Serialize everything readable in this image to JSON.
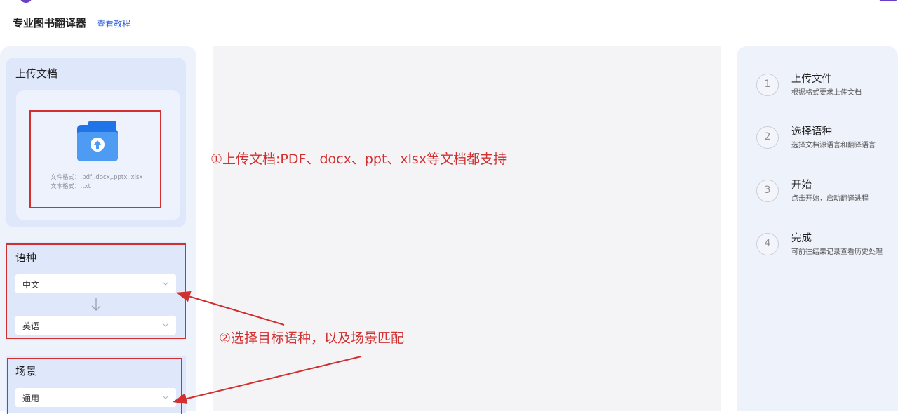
{
  "header": {
    "app_title": "专业图书翻译器",
    "tutorial_link": "查看教程"
  },
  "upload": {
    "heading": "上传文档",
    "file_formats": "文件格式：.pdf,.docx,.pptx,.xlsx",
    "text_formats": "文本格式：.txt",
    "icon": "folder-upload-icon"
  },
  "language": {
    "heading": "语种",
    "source": "中文",
    "target": "英语"
  },
  "scene": {
    "heading": "场景",
    "value": "通用"
  },
  "steps": [
    {
      "number": "1",
      "title": "上传文件",
      "desc": "根据格式要求上传文档"
    },
    {
      "number": "2",
      "title": "选择语种",
      "desc": "选择文档源语言和翻译语言"
    },
    {
      "number": "3",
      "title": "开始",
      "desc": "点击开始，启动翻译进程"
    },
    {
      "number": "4",
      "title": "完成",
      "desc": "可前往结果记录查看历史处理"
    }
  ],
  "annotations": {
    "note_upload": "①上传文档:PDF、docx、ppt、xlsx等文档都支持",
    "note_language": "②选择目标语种，以及场景匹配"
  },
  "colors": {
    "accent_blue": "#2a5bd7",
    "folder_blue": "#3f8ff0",
    "annotation_red": "#d03030",
    "panel_bg": "#eef2fb"
  }
}
